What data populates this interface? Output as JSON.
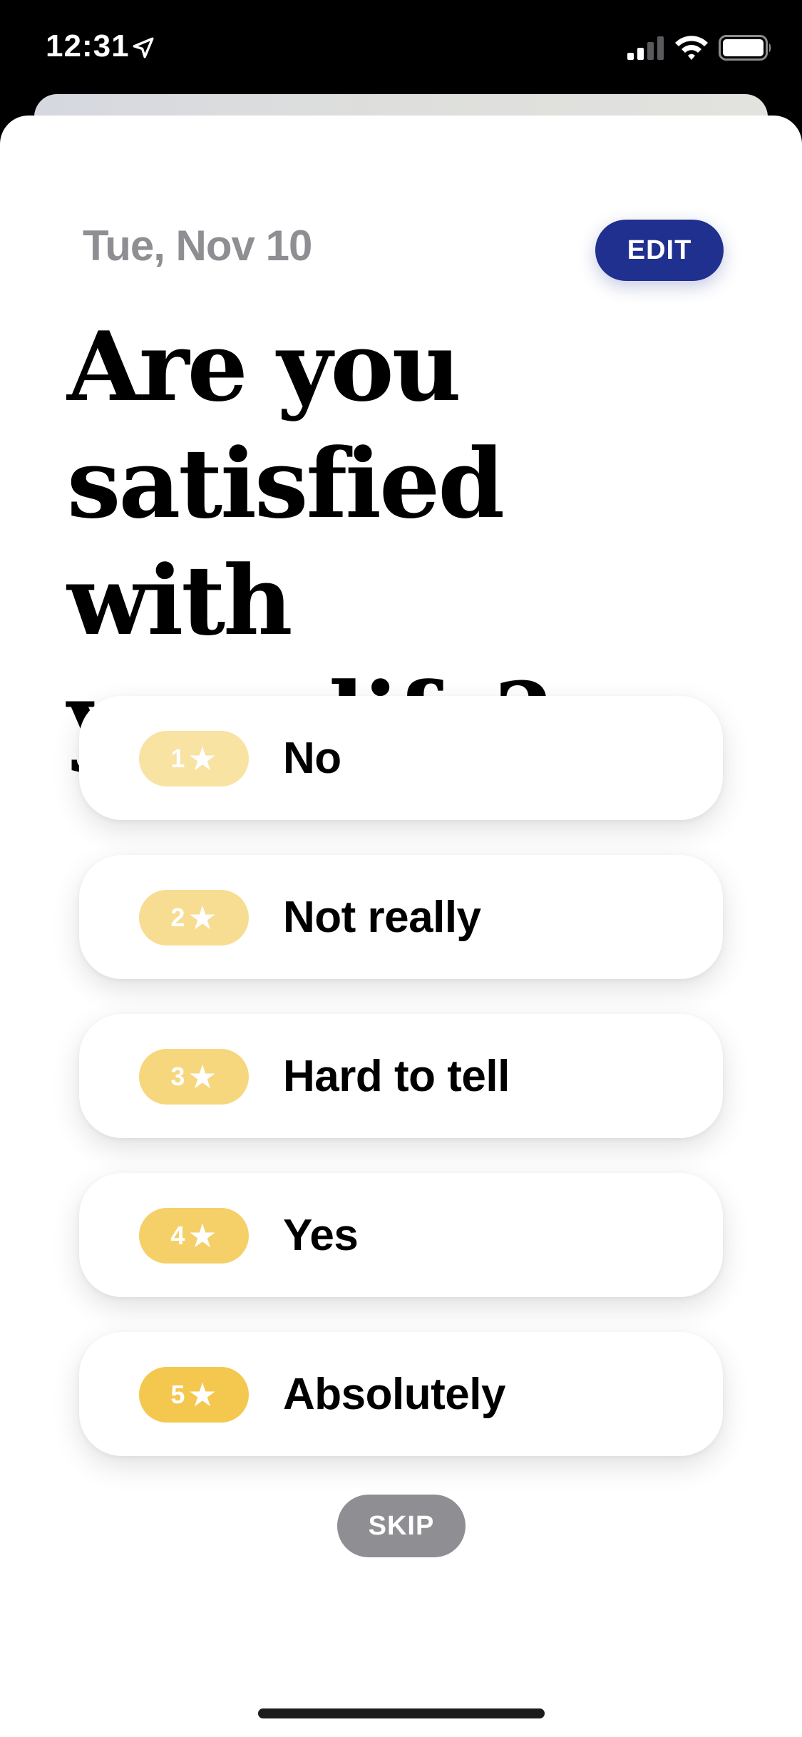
{
  "status_bar": {
    "time": "12:31",
    "location_icon": "location-arrow-icon",
    "signal_icon": "cellular-signal-icon",
    "wifi_icon": "wifi-icon",
    "battery_icon": "battery-icon"
  },
  "header": {
    "date": "Tue, Nov 10",
    "edit_label": "EDIT",
    "edit_color": "#20308f"
  },
  "question": {
    "line1": "Are you",
    "line2": "satisfied with",
    "line3": "your life?"
  },
  "options": [
    {
      "rating": "1",
      "star": "★",
      "label": "No",
      "badge_color": "#f8e3a3"
    },
    {
      "rating": "2",
      "star": "★",
      "label": "Not really",
      "badge_color": "#f7dd92"
    },
    {
      "rating": "3",
      "star": "★",
      "label": "Hard to tell",
      "badge_color": "#f6d77d"
    },
    {
      "rating": "4",
      "star": "★",
      "label": "Yes",
      "badge_color": "#f5d068"
    },
    {
      "rating": "5",
      "star": "★",
      "label": "Absolutely",
      "badge_color": "#f4c84f"
    }
  ],
  "skip_label": "SKIP"
}
